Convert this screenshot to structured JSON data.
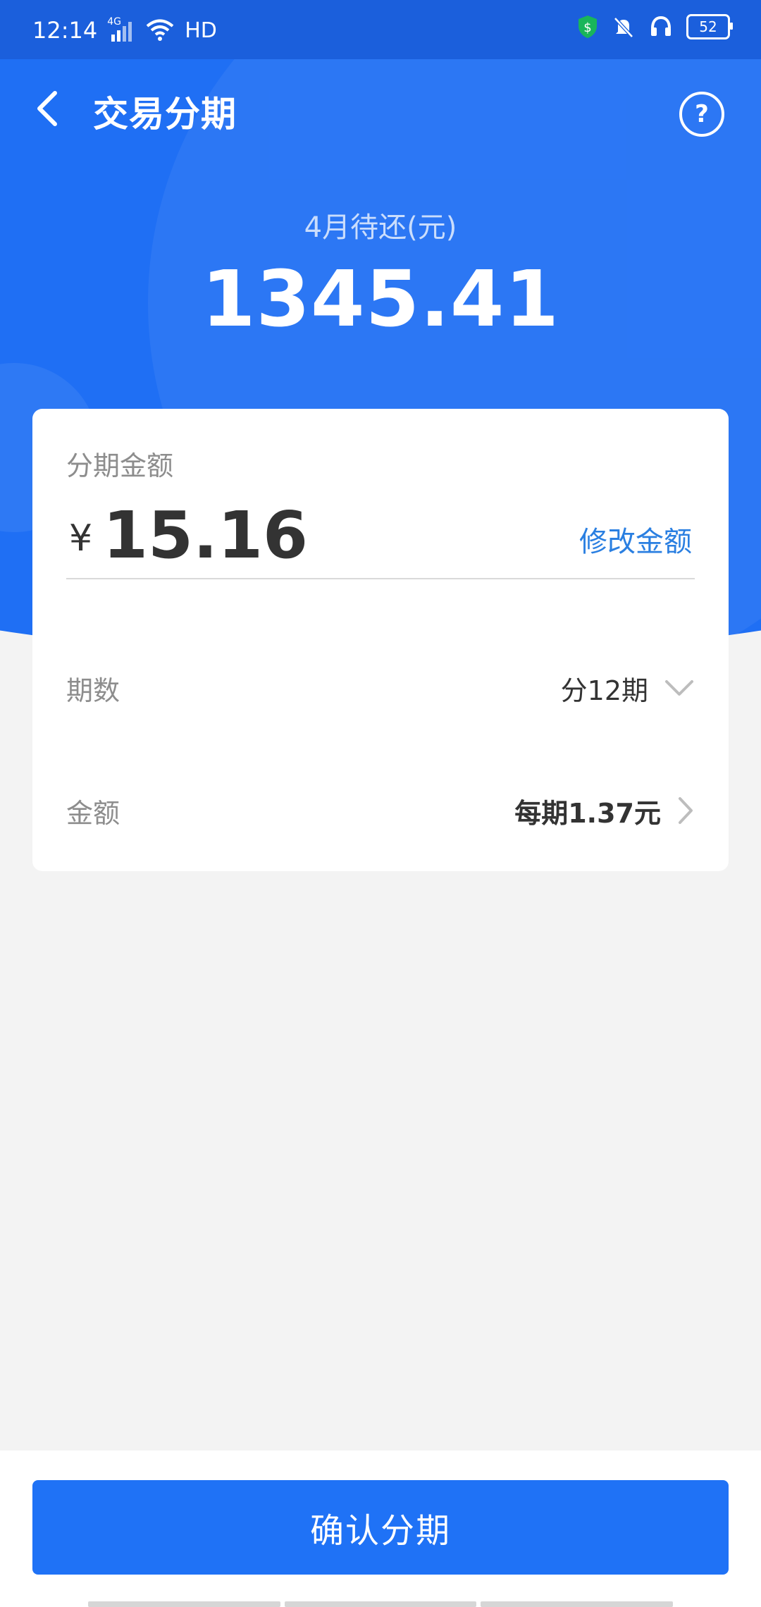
{
  "status_bar": {
    "time": "12:14",
    "network_tag": "4G",
    "hd": "HD",
    "battery": "52"
  },
  "header": {
    "title": "交易分期",
    "help_symbol": "?"
  },
  "hero": {
    "due_label": "4月待还(元)",
    "due_amount": "1345.41"
  },
  "card": {
    "amount_label": "分期金额",
    "currency": "¥",
    "amount": "15.16",
    "modify_label": "修改金额",
    "periods_label": "期数",
    "periods_value": "分12期",
    "payment_label": "金额",
    "payment_value": "每期1.37元"
  },
  "footer": {
    "confirm_label": "确认分期"
  },
  "colors": {
    "primary": "#1f6ff4",
    "link": "#2a7fe1",
    "background": "#f3f3f3"
  },
  "icons": {
    "back": "chevron-left-icon",
    "help": "question-circle-icon",
    "dropdown": "chevron-down-icon",
    "next": "chevron-right-icon"
  }
}
